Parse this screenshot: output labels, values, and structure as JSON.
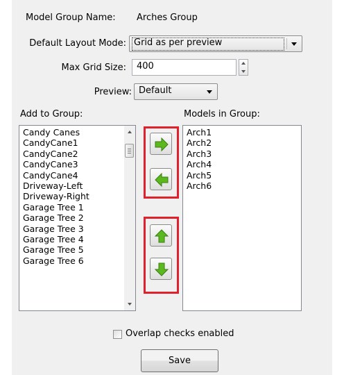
{
  "model_group_name": {
    "label": "Model Group Name:",
    "value": "Arches Group"
  },
  "default_layout_mode": {
    "label": "Default Layout Mode:",
    "value": "Grid as per preview"
  },
  "max_grid_size": {
    "label": "Max Grid Size:",
    "value": "400"
  },
  "preview": {
    "label": "Preview:",
    "value": "Default"
  },
  "add_to_group": {
    "label": "Add to Group:",
    "items": [
      "Candy Canes",
      "CandyCane1",
      "CandyCane2",
      "CandyCane3",
      "CandyCane4",
      "Driveway-Left",
      "Driveway-Right",
      "Garage Tree 1",
      "Garage Tree 2",
      "Garage Tree 3",
      "Garage Tree 4",
      "Garage Tree 5",
      "Garage Tree 6"
    ]
  },
  "models_in_group": {
    "label": "Models in Group:",
    "items": [
      "Arch1",
      "Arch2",
      "Arch3",
      "Arch4",
      "Arch5",
      "Arch6"
    ]
  },
  "overlap_checks": {
    "label": "Overlap checks enabled",
    "checked": false
  },
  "save_button": {
    "label": "Save"
  },
  "colors": {
    "highlight_box": "#e0202a",
    "arrow_green": "#5cb81f",
    "panel": "#f0f0f0"
  },
  "icons": [
    "arrow-right-icon",
    "arrow-left-icon",
    "arrow-up-icon",
    "arrow-down-icon"
  ]
}
